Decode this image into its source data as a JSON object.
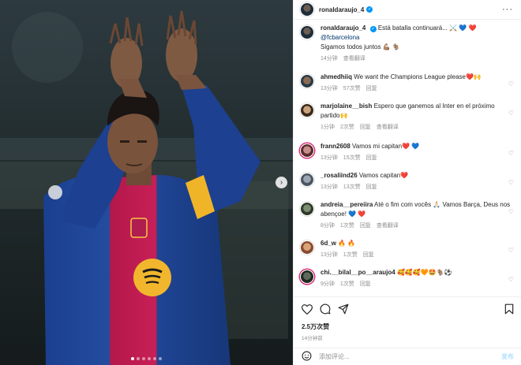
{
  "post": {
    "username": "ronaldaraujo_4",
    "caption_user": "ronaldaraujo_4",
    "caption_text": "Está batalla continuará... ⚔️ 💙 ❤️",
    "caption_mention": "@fcbarcelona",
    "caption_line2": "Sigamos todos juntos 💪🏽 🐐",
    "caption_time": "14分钟",
    "caption_translate": "查看翻译",
    "likes": "2.5万次赞",
    "time": "14分钟前",
    "comment_placeholder": "添加评论...",
    "post_button": "发布",
    "carousel_dots": 6,
    "carousel_active": 0
  },
  "comments": [
    {
      "user": "ahmedhiiq",
      "text": "We want the Champions League please❤️🙌",
      "time": "13分钟",
      "likes": "57次赞",
      "reply": "回复"
    },
    {
      "user": "marjolaine__bish",
      "text": "Espero que ganemos al Inter en el próximo partido🙌",
      "time": "1分钟",
      "likes": "2次赞",
      "reply": "回复",
      "translate": "查看翻译"
    },
    {
      "user": "frann2608",
      "text": "Vamos mi capitan❤️ 💙",
      "time": "13分钟",
      "likes": "15次赞",
      "reply": "回复"
    },
    {
      "user": "_rosaliind26",
      "text": "Vamos capitan❤️",
      "time": "13分钟",
      "likes": "13次赞",
      "reply": "回复"
    },
    {
      "user": "andreia__pereiira",
      "text": "Até o fim com vocês 🙏🏻 Vamos Barça, Deus nos abençoe! 💙 ❤️",
      "time": "8分钟",
      "likes": "1次赞",
      "reply": "回复",
      "translate": "查看翻译"
    },
    {
      "user": "6d_w",
      "text": "🔥 🔥",
      "time": "13分钟",
      "likes": "1次赞",
      "reply": "回复"
    },
    {
      "user": "chi.__bilal__po__araujo4",
      "text": "🥰🥰🥰🧡🤩🐐⚽",
      "time": "9分钟",
      "likes": "1次赞",
      "reply": "回复"
    }
  ],
  "icons": {
    "more": "more-horizontal-icon",
    "next": "chevron-right-icon",
    "like": "heart-icon",
    "comment": "comment-icon",
    "share": "send-icon",
    "save": "bookmark-icon",
    "emoji": "emoji-icon"
  },
  "colors": {
    "verified": "#0095f6",
    "mention": "#00376b",
    "muted": "#8e8e8e",
    "post_button": "#b2dffc"
  }
}
